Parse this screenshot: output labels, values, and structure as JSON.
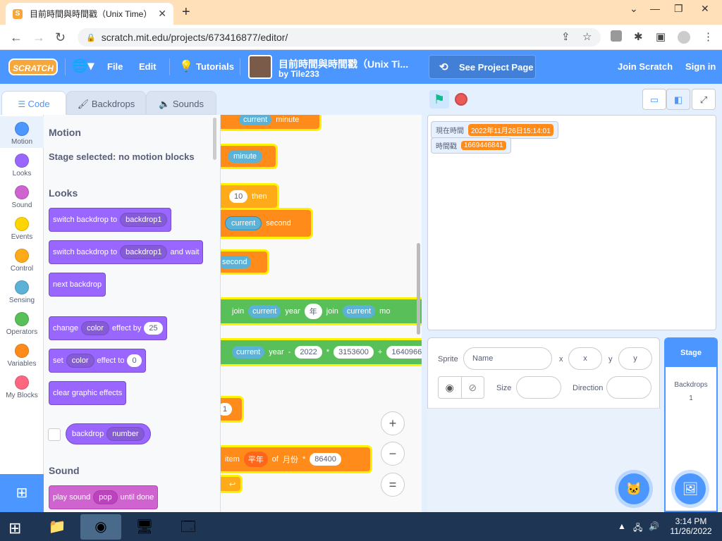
{
  "browser": {
    "tab_title": "目前時間與時間戳（Unix Time）",
    "tab_close": "✕",
    "new_tab": "+",
    "url": "scratch.mit.edu/projects/673416877/editor/"
  },
  "menubar": {
    "logo": "SCRATCH",
    "file": "File",
    "edit": "Edit",
    "tutorials": "Tutorials",
    "project_title": "目前時間與時間戳（Unix Ti...",
    "project_by": "by Tile233",
    "see_project": "See Project Page",
    "join": "Join Scratch",
    "signin": "Sign in"
  },
  "editor_tabs": [
    {
      "label": "Code",
      "active": true
    },
    {
      "label": "Backdrops",
      "active": false
    },
    {
      "label": "Sounds",
      "active": false
    }
  ],
  "categories": [
    {
      "label": "Motion",
      "color": "#4c97ff"
    },
    {
      "label": "Looks",
      "color": "#9966ff"
    },
    {
      "label": "Sound",
      "color": "#cf63cf"
    },
    {
      "label": "Events",
      "color": "#ffd500"
    },
    {
      "label": "Control",
      "color": "#ffab19"
    },
    {
      "label": "Sensing",
      "color": "#5cb1d6"
    },
    {
      "label": "Operators",
      "color": "#59c059"
    },
    {
      "label": "Variables",
      "color": "#ff8c1a"
    },
    {
      "label": "My Blocks",
      "color": "#ff6680"
    }
  ],
  "palette": {
    "motion_head": "Motion",
    "motion_note": "Stage selected: no motion blocks",
    "looks_head": "Looks",
    "sound_head": "Sound",
    "b1": {
      "text": "switch backdrop to",
      "dd": "backdrop1"
    },
    "b2": {
      "text": "switch backdrop to",
      "dd": "backdrop1",
      "tail": "and wait"
    },
    "b3": {
      "text": "next backdrop"
    },
    "b4": {
      "text": "change",
      "dd": "color",
      "mid": "effect by",
      "num": "25"
    },
    "b5": {
      "text": "set",
      "dd": "color",
      "mid": "effect to",
      "num": "0"
    },
    "b6": {
      "text": "clear graphic effects"
    },
    "b7": {
      "text": "backdrop",
      "dd": "number"
    },
    "b8": {
      "text": "play sound",
      "dd": "pop",
      "tail": "until done"
    }
  },
  "script": {
    "r1": {
      "a": "current",
      "b": "minute"
    },
    "r2": {
      "a": "minute"
    },
    "r3": {
      "a": "10",
      "b": "then"
    },
    "r4": {
      "a": "current",
      "b": "second"
    },
    "r5": {
      "a": "second"
    },
    "r6": {
      "a": "join",
      "b": "current",
      "c": "year",
      "d": "年",
      "e": "join",
      "f": "current",
      "g": "mo"
    },
    "r7": {
      "a": "current",
      "b": "year",
      "c": "2022",
      "d": "3153600",
      "e": "1640966"
    },
    "r8": {
      "a": "1"
    },
    "r9": {
      "a": "item",
      "b": "平年",
      "c": "of",
      "d": "月份",
      "e": "86400"
    },
    "op_minus": "-",
    "op_times": "*",
    "op_plus": "+"
  },
  "zoom": {
    "in": "+",
    "out": "−",
    "reset": "="
  },
  "stage": {
    "monitor1_label": "現在時間",
    "monitor1_value": "2022年11月26日15:14:01",
    "monitor2_label": "時間戳",
    "monitor2_value": "1669446841"
  },
  "sprite_info": {
    "sprite_label": "Sprite",
    "name_placeholder": "Name",
    "x_label": "x",
    "x_placeholder": "x",
    "y_label": "y",
    "y_placeholder": "y",
    "size_label": "Size",
    "direction_label": "Direction"
  },
  "stage_pane": {
    "title": "Stage",
    "backdrops_label": "Backdrops",
    "backdrops_count": "1"
  },
  "taskbar": {
    "time": "3:14 PM",
    "date": "11/26/2022"
  }
}
